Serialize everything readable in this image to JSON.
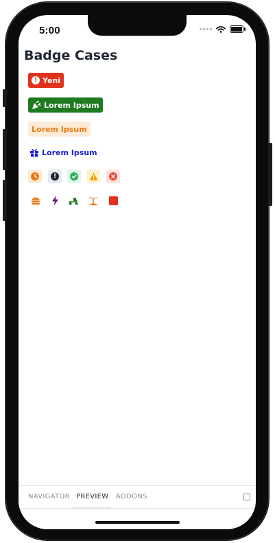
{
  "status_bar": {
    "time": "5:00"
  },
  "page": {
    "title": "Badge Cases"
  },
  "badges": {
    "new": {
      "label": "Yeni",
      "icon": "exclamation-circle-icon",
      "bg": "#e0321c"
    },
    "green": {
      "label": "Lorem Ipsum",
      "icon": "party-popper-icon",
      "bg": "#1f7a1f"
    },
    "orange": {
      "label": "Lorem Ipsum",
      "bg": "#fdebd7",
      "color": "#ea7a12"
    },
    "blue": {
      "label": "Lorem Ipsum",
      "icon": "gift-icon",
      "color": "#1a1fd6"
    }
  },
  "status_icons": [
    {
      "icon": "clock-icon",
      "color": "#ea7a12"
    },
    {
      "icon": "exclamation-icon",
      "color": "#1f2633"
    },
    {
      "icon": "check-icon",
      "color": "#2fae5b"
    },
    {
      "icon": "warning-icon",
      "color": "#f0a400"
    },
    {
      "icon": "close-icon",
      "color": "#ee4b3e"
    }
  ],
  "misc_icons": [
    {
      "icon": "burger-icon",
      "color": "#ea7a12"
    },
    {
      "icon": "lightning-icon",
      "color": "#6a1d73"
    },
    {
      "icon": "scooter-icon",
      "color": "#1f7a1f"
    },
    {
      "icon": "island-icon",
      "color": "#ea7a12"
    },
    {
      "icon": "stop-square-icon",
      "color": "#e0321c"
    }
  ],
  "tabs": [
    {
      "label": "NAVIGATOR",
      "active": false
    },
    {
      "label": "PREVIEW",
      "active": true
    },
    {
      "label": "ADDONS",
      "active": false
    }
  ]
}
